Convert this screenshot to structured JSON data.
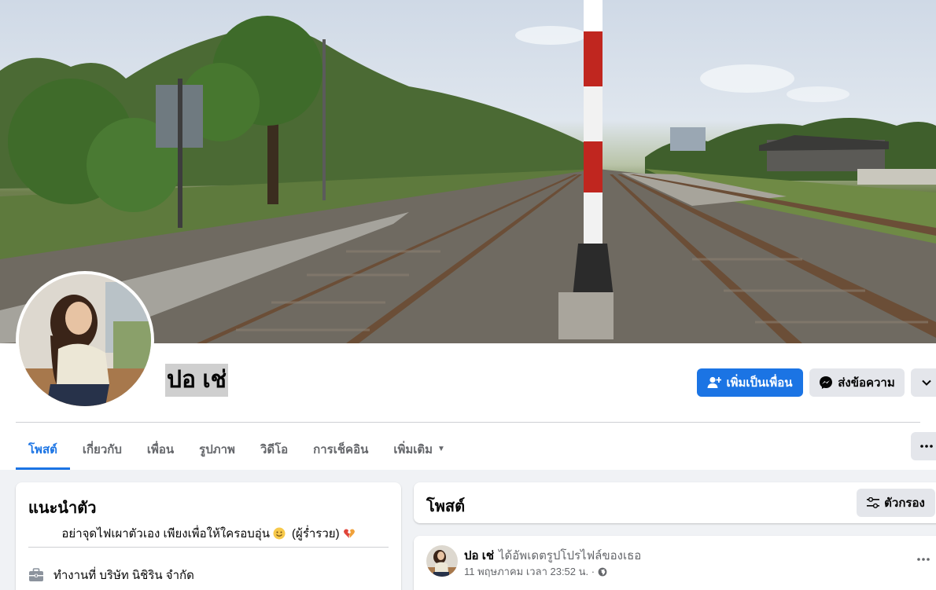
{
  "profile": {
    "name": "ปอ เช่"
  },
  "actions": {
    "add_friend": "เพิ่มเป็นเพื่อน",
    "message": "ส่งข้อความ"
  },
  "tabs": [
    {
      "label": "โพสต์"
    },
    {
      "label": "เกี่ยวกับ"
    },
    {
      "label": "เพื่อน"
    },
    {
      "label": "รูปภาพ"
    },
    {
      "label": "วิดีโอ"
    },
    {
      "label": "การเช็คอิน"
    },
    {
      "label": "เพิ่มเติม"
    }
  ],
  "intro": {
    "title": "แนะนำตัว",
    "bio": "อย่าจุดไฟเผาตัวเอง เพียงเพื่อให้ใครอบอุ่น",
    "bio_suffix": "(ผู้ร่ำรวย)",
    "work": "ทำงานที่ บริษัท นิชิริน จำกัด"
  },
  "posts": {
    "title": "โพสต์",
    "filter_label": "ตัวกรอง",
    "item": {
      "author": "ปอ เช่",
      "action": "ได้อัพเดตรูปโปรไฟล์ของเธอ",
      "time": "11 พฤษภาคม เวลา 23:52 น. ·"
    }
  },
  "colors": {
    "accent": "#1b74e4",
    "secondary_button": "#e4e6eb",
    "muted_text": "#65676b",
    "page_bg": "#f0f2f5"
  },
  "icons": {
    "add_friend": "person-plus-icon",
    "message": "messenger-icon",
    "more_options": "chevron-down-icon",
    "tab_more": "ellipsis-icon",
    "filter": "sliders-icon",
    "work": "briefcase-icon",
    "privacy": "globe-icon",
    "emoji": "smile-emoji-icon",
    "heart": "broken-heart-emoji-icon"
  }
}
